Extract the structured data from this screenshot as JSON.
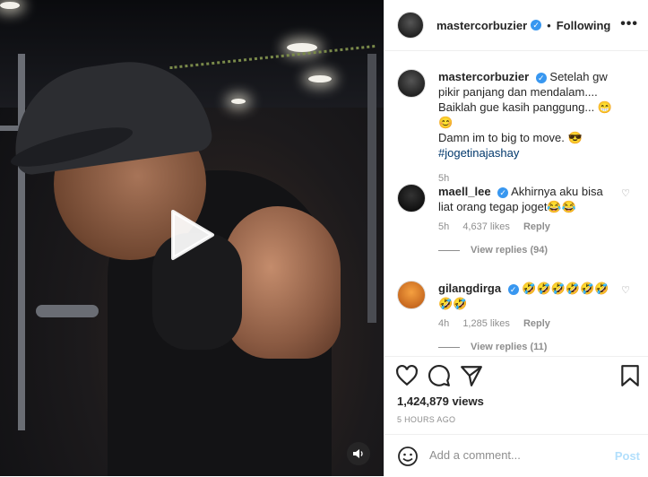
{
  "post": {
    "author": "mastercorbuzier",
    "follow_status": "Following",
    "separator": "•",
    "more_label": "•••"
  },
  "caption": {
    "username": "mastercorbuzier",
    "line1": "Setelah gw pikir panjang dan mendalam.... Baiklah gue kasih panggung... 😁😊",
    "line2": "Damn im to big to move. 😎",
    "hashtag": "#jogetinajashay",
    "time": "5h"
  },
  "comments": [
    {
      "username": "maell_lee",
      "text": "Akhirnya aku bisa liat orang tegap joget😂😂",
      "time": "5h",
      "likes": "4,637 likes",
      "reply": "Reply",
      "view_replies": "View replies (94)"
    },
    {
      "username": "gilangdirga",
      "text": "🤣🤣🤣🤣🤣🤣🤣🤣",
      "time": "4h",
      "likes": "1,285 likes",
      "reply": "Reply",
      "view_replies": "View replies (11)"
    }
  ],
  "stats": {
    "views": "1,424,879 views",
    "ago": "5 HOURS AGO"
  },
  "add_comment": {
    "placeholder": "Add a comment...",
    "post_label": "Post"
  },
  "icons": {
    "play": "play-icon",
    "mute": "speaker-icon",
    "like": "heart-icon",
    "comment": "comment-bubble-icon",
    "share": "paper-plane-icon",
    "save": "bookmark-icon",
    "emoji": "smiley-icon"
  },
  "colors": {
    "verified": "#3897f0",
    "post_button": "#b2dffc",
    "hashtag": "#00376b"
  }
}
